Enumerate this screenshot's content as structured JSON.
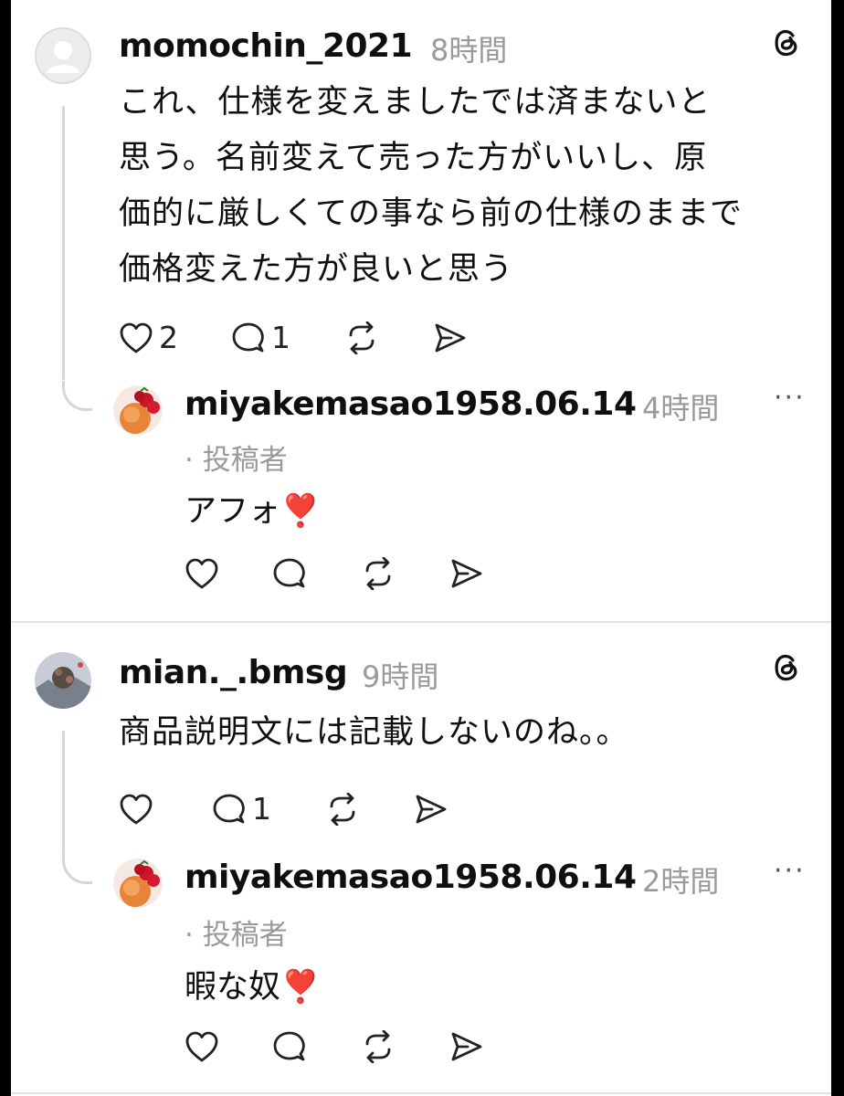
{
  "threads": [
    {
      "author": "momochin_2021",
      "time": "8時間",
      "text": "これ、仕様を変えましたでは済まないと\n思う。名前変えて売った方がいいし、原\n価的に厳しくての事なら前の仕様のままで\n価格変えた方が良いと思う",
      "likes": "2",
      "replies": "1",
      "reply": {
        "author": "miyakemasao1958.06.14",
        "time": "4時間",
        "role": "· 投稿者",
        "text": "アフォ",
        "emoji": "❣️"
      }
    },
    {
      "author": "mian._.bmsg",
      "time": "9時間",
      "text": "商品説明文には記載しないのね。。",
      "likes": "",
      "replies": "1",
      "reply": {
        "author": "miyakemasao1958.06.14",
        "time": "2時間",
        "role": "· 投稿者",
        "text": "暇な奴",
        "emoji": "❣️"
      }
    }
  ],
  "more_glyph": "···",
  "colors": {
    "text": "#0f0f0f",
    "muted": "#9a9a9a",
    "line": "#d6d6d6",
    "emoji": "#e0212d"
  }
}
